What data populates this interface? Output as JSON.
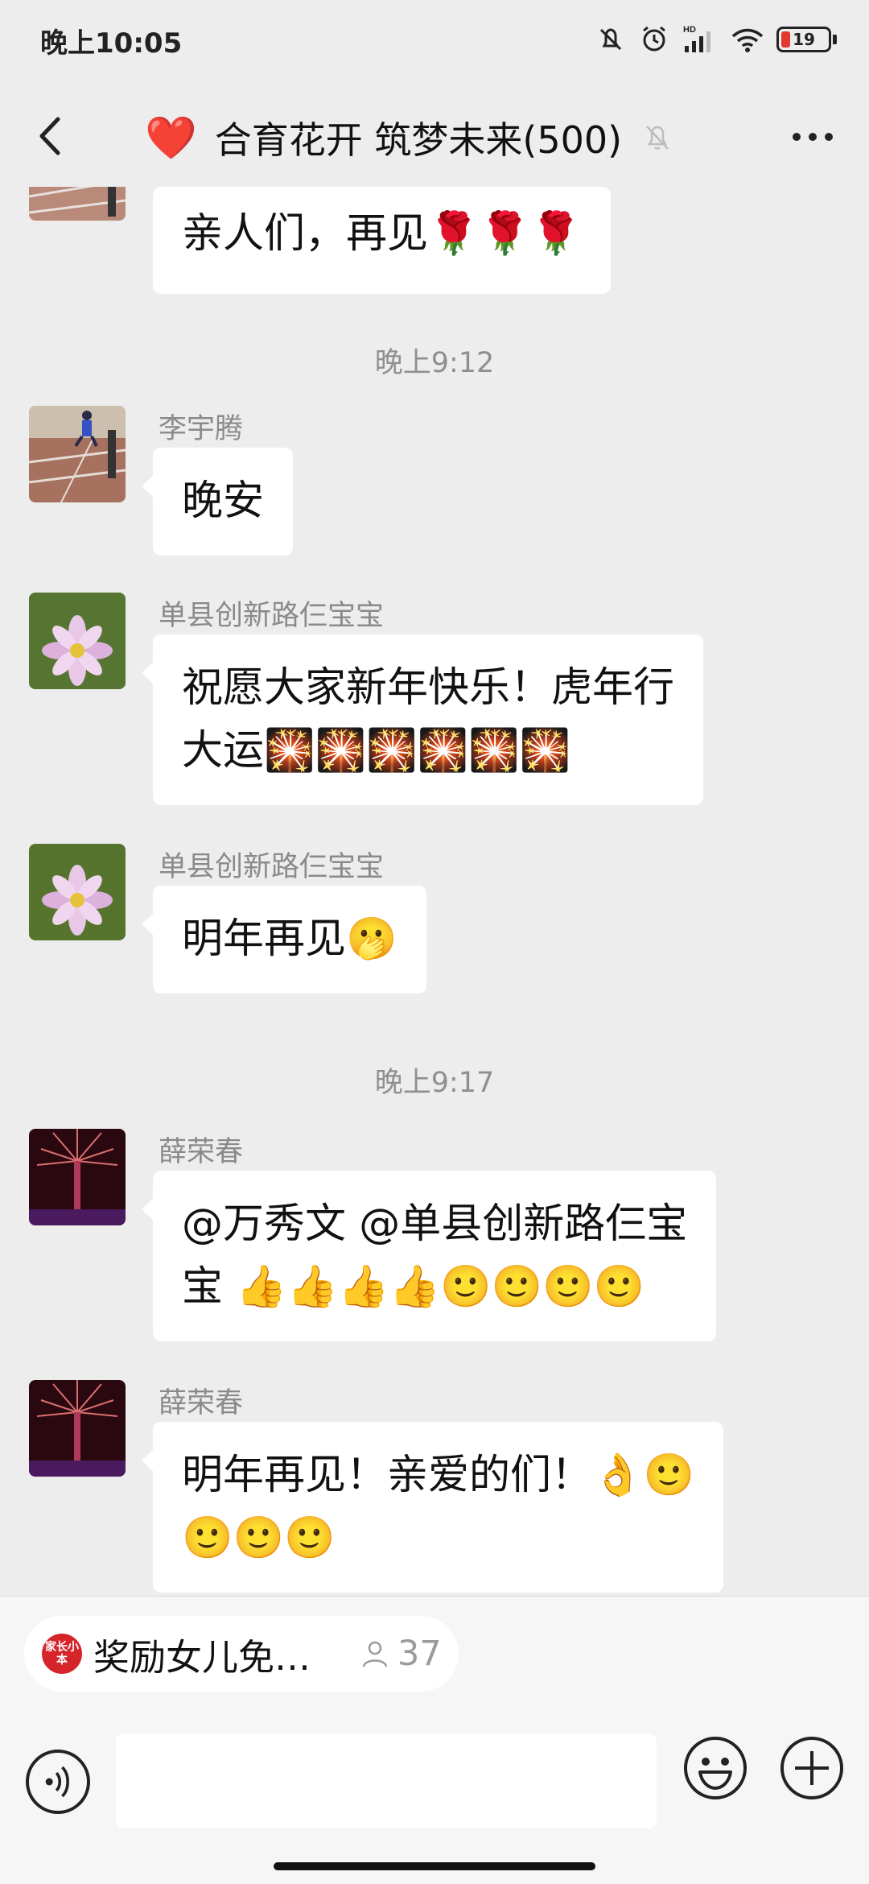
{
  "status_bar": {
    "time": "晚上10:05",
    "battery": "19",
    "battery_level": 0.19,
    "network": "HD"
  },
  "header": {
    "title": "合育花开 筑梦未来(500)",
    "heart": "❤️"
  },
  "messages": [
    {
      "sender": "",
      "text": "亲人们，再见🌹🌹🌹"
    },
    {
      "timestamp": "晚上9:12"
    },
    {
      "sender": "李宇腾",
      "text": "晚安"
    },
    {
      "sender": "单县创新路仨宝宝",
      "line1": "祝愿大家新年快乐！虎年行",
      "line2": "大运🎇🎇🎇🎇🎇🎇"
    },
    {
      "sender": "单县创新路仨宝宝",
      "text": "明年再见🫢"
    },
    {
      "timestamp": "晚上9:17"
    },
    {
      "sender": "薛荣春",
      "line1": "@万秀文 @单县创新路仨宝",
      "line2": "宝 👍👍👍👍🙂🙂🙂🙂"
    },
    {
      "sender": "薛荣春",
      "line1": "明年再见！亲爱的们！👌🙂",
      "line2": "🙂🙂🙂"
    }
  ],
  "mini_program": {
    "logo": "家长小本",
    "title": "奖励女儿免…",
    "count": "37"
  },
  "colors": {
    "background": "#ededed",
    "bubble": "#ffffff",
    "accent_red": "#d6242b"
  }
}
